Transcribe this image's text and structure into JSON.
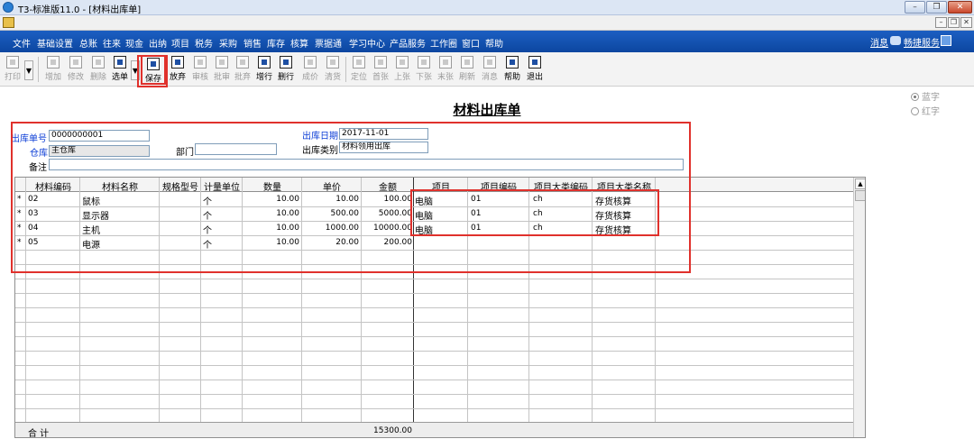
{
  "window": {
    "title": "T3-标准版11.0 - [材料出库单]",
    "min": "–",
    "restore": "❐",
    "close": "✕"
  },
  "mdi": {
    "min": "–",
    "restore": "❐",
    "close": "✕"
  },
  "menu": {
    "items": [
      "文件",
      "基础设置",
      "总账",
      "往来",
      "现金",
      "出纳",
      "项目",
      "税务",
      "采购",
      "销售",
      "库存",
      "核算",
      "票据通",
      "学习中心",
      "产品服务",
      "工作圈",
      "窗口",
      "帮助"
    ],
    "message": "消息",
    "service": "畅捷服务"
  },
  "toolbar": {
    "print": "打印",
    "add": "增加",
    "edit": "修改",
    "delete": "删除",
    "select": "选单",
    "save": "保存",
    "discard": "放弃",
    "audit": "审核",
    "approve": "批审",
    "batch_approve": "批弃",
    "add_row": "增行",
    "delete_row": "删行",
    "cost": "成价",
    "clear": "清货",
    "locate": "定位",
    "first": "首张",
    "prev": "上张",
    "next": "下张",
    "last": "末张",
    "refresh": "刷新",
    "message": "消息",
    "help": "帮助",
    "exit": "退出",
    "dropdown": "▼"
  },
  "form": {
    "title": "材料出库单",
    "radio_blue": "蓝字",
    "radio_red": "红字",
    "doc_no_label": "出库单号",
    "doc_no": "0000000001",
    "date_label": "出库日期",
    "date": "2017-11-01",
    "warehouse_label": "仓库",
    "warehouse": "主仓库",
    "dept_label": "部门",
    "dept": "",
    "type_label": "出库类别",
    "type": "材料领用出库",
    "remark_label": "备注",
    "remark": ""
  },
  "table": {
    "columns": [
      "材料编码",
      "材料名称",
      "规格型号",
      "计量单位",
      "数量",
      "单价",
      "金额",
      "项目",
      "项目编码",
      "项目大类编码",
      "项目大类名称"
    ],
    "rows": [
      {
        "mark": "*",
        "code": "02",
        "name": "鼠标",
        "spec": "",
        "unit": "个",
        "qty": "10.00",
        "price": "10.00",
        "amount": "100.00",
        "project": "电脑",
        "project_code": "01",
        "class_code": "ch",
        "class_name": "存货核算"
      },
      {
        "mark": "*",
        "code": "03",
        "name": "显示器",
        "spec": "",
        "unit": "个",
        "qty": "10.00",
        "price": "500.00",
        "amount": "5000.00",
        "project": "电脑",
        "project_code": "01",
        "class_code": "ch",
        "class_name": "存货核算"
      },
      {
        "mark": "*",
        "code": "04",
        "name": "主机",
        "spec": "",
        "unit": "个",
        "qty": "10.00",
        "price": "1000.00",
        "amount": "10000.00",
        "project": "电脑",
        "project_code": "01",
        "class_code": "ch",
        "class_name": "存货核算"
      },
      {
        "mark": "*",
        "code": "05",
        "name": "电源",
        "spec": "",
        "unit": "个",
        "qty": "10.00",
        "price": "20.00",
        "amount": "200.00",
        "project": "",
        "project_code": "",
        "class_code": "",
        "class_name": ""
      }
    ],
    "total_label": "合  计",
    "total_amount": "15300.00"
  }
}
